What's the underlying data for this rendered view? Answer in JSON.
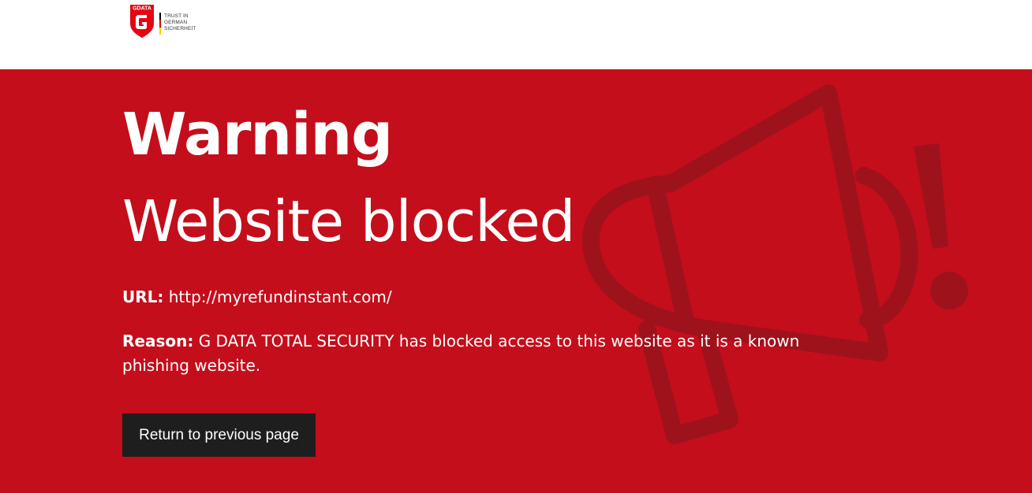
{
  "header": {
    "logo": {
      "brand": "GDATA",
      "tagline": "TRUST IN\nGERMAN\nSICHERHEIT",
      "icon": "gdata-shield-logo-icon",
      "colors": {
        "shield": "#e30613",
        "flag_black": "#000000",
        "flag_red": "#dd0000",
        "flag_gold": "#ffce00"
      }
    }
  },
  "warning": {
    "title": "Warning",
    "subtitle": "Website blocked",
    "url_label": "URL:",
    "url_value": "http://myrefundinstant.com/",
    "reason_label": "Reason:",
    "reason_value": "G DATA TOTAL SECURITY has blocked access to this website as it is a known phishing website.",
    "background_icon": "megaphone-icon",
    "colors": {
      "background": "#c40e1b",
      "text": "#ffffff",
      "icon_overlay": "#9e121c"
    }
  },
  "actions": {
    "return_label": "Return to previous page",
    "colors": {
      "button_bg": "#1e1e1e",
      "button_text": "#ffffff"
    }
  }
}
